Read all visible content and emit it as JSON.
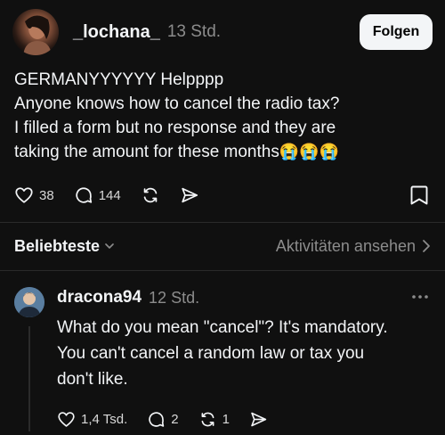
{
  "post": {
    "author": "_lochana_",
    "time": "13 Std.",
    "follow_label": "Folgen",
    "lines": [
      "GERMANYYYYYY Helpppp",
      "Anyone knows how to cancel the radio tax?",
      "I filled a form but no response and they are",
      "taking the amount for these months"
    ],
    "emoji": "😭😭😭",
    "likes": "38",
    "comments": "144",
    "icons": [
      "heart-icon",
      "comment-icon",
      "repost-icon",
      "share-icon",
      "bookmark-icon"
    ]
  },
  "sort": {
    "label": "Beliebteste",
    "activity_label": "Aktivitäten ansehen"
  },
  "reply": {
    "author": "dracona94",
    "time": "12 Std.",
    "lines": [
      "What do you mean \"cancel\"? It's mandatory.",
      "You can't cancel a random law or tax you",
      "don't like."
    ],
    "likes": "1,4 Tsd.",
    "comments": "2",
    "reposts": "1"
  },
  "colors": {
    "background": "#101010",
    "text": "#f3f5f7",
    "muted": "#8c8c8c",
    "button": "#f3f5f7"
  }
}
